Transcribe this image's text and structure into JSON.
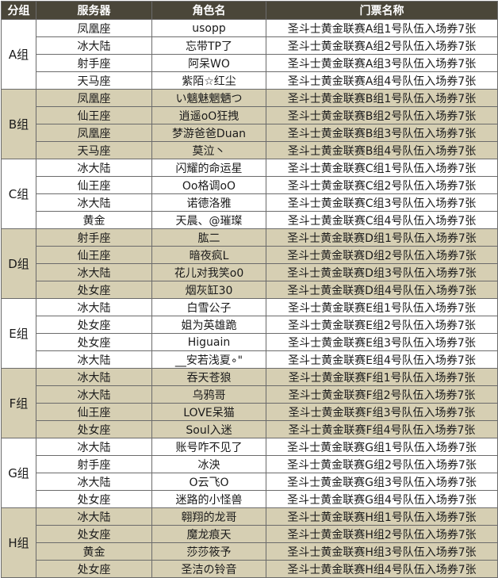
{
  "headers": {
    "group": "分组",
    "server": "服务器",
    "role": "角色名",
    "ticket": "门票名称"
  },
  "groups": [
    {
      "name": "A组",
      "rows": [
        {
          "server": "凤凰座",
          "role": "usopp",
          "ticket": "圣斗士黄金联赛A组1号队伍入场券7张"
        },
        {
          "server": "冰大陆",
          "role": "忘带TP了",
          "ticket": "圣斗士黄金联赛A组2号队伍入场券7张"
        },
        {
          "server": "射手座",
          "role": "阿呆WO",
          "ticket": "圣斗士黄金联赛A组3号队伍入场券7张"
        },
        {
          "server": "天马座",
          "role": "紫陌☆红尘",
          "ticket": "圣斗士黄金联赛A组4号队伍入场券7张"
        }
      ]
    },
    {
      "name": "B组",
      "rows": [
        {
          "server": "凤凰座",
          "role": "い魑魅魍魉つ",
          "ticket": "圣斗士黄金联赛B组1号队伍入场券7张"
        },
        {
          "server": "仙王座",
          "role": "逍遥oO狂拽",
          "ticket": "圣斗士黄金联赛B组2号队伍入场券7张"
        },
        {
          "server": "凤凰座",
          "role": "梦游爸爸Duan",
          "ticket": "圣斗士黄金联赛B组3号队伍入场券7张"
        },
        {
          "server": "天马座",
          "role": "莫泣丶",
          "ticket": "圣斗士黄金联赛B组4号队伍入场券7张"
        }
      ]
    },
    {
      "name": "C组",
      "rows": [
        {
          "server": "冰大陆",
          "role": "闪耀的命运星",
          "ticket": "圣斗士黄金联赛C组1号队伍入场券7张"
        },
        {
          "server": "仙王座",
          "role": "Oo格调oO",
          "ticket": "圣斗士黄金联赛C组2号队伍入场券7张"
        },
        {
          "server": "冰大陆",
          "role": "诺德洛雅",
          "ticket": "圣斗士黄金联赛C组3号队伍入场券7张"
        },
        {
          "server": "黄金",
          "role": "天晨、@璀璨",
          "ticket": "圣斗士黄金联赛C组4号队伍入场券7张"
        }
      ]
    },
    {
      "name": "D组",
      "rows": [
        {
          "server": "射手座",
          "role": "肱二",
          "ticket": "圣斗士黄金联赛D组1号队伍入场券7张"
        },
        {
          "server": "仙王座",
          "role": "暗夜疯L",
          "ticket": "圣斗士黄金联赛D组2号队伍入场券7张"
        },
        {
          "server": "冰大陆",
          "role": "花儿对我笑o0",
          "ticket": "圣斗士黄金联赛D组3号队伍入场券7张"
        },
        {
          "server": "处女座",
          "role": "烟灰缸30",
          "ticket": "圣斗士黄金联赛D组4号队伍入场券7张"
        }
      ]
    },
    {
      "name": "E组",
      "rows": [
        {
          "server": "冰大陆",
          "role": "白雪公子",
          "ticket": "圣斗士黄金联赛E组1号队伍入场券7张"
        },
        {
          "server": "处女座",
          "role": "姐为英雄跪",
          "ticket": "圣斗士黄金联赛E组2号队伍入场券7张"
        },
        {
          "server": "处女座",
          "role": "Higuain",
          "ticket": "圣斗士黄金联赛E组3号队伍入场券7张"
        },
        {
          "server": "冰大陆",
          "role": "__安若浅夏∘\"",
          "ticket": "圣斗士黄金联赛E组4号队伍入场券7张"
        }
      ]
    },
    {
      "name": "F组",
      "rows": [
        {
          "server": "冰大陆",
          "role": "吞天苍狼",
          "ticket": "圣斗士黄金联赛F组1号队伍入场券7张"
        },
        {
          "server": "冰大陆",
          "role": "乌鸦哥",
          "ticket": "圣斗士黄金联赛F组2号队伍入场券7张"
        },
        {
          "server": "仙王座",
          "role": "LOVE呆猫",
          "ticket": "圣斗士黄金联赛F组3号队伍入场券7张"
        },
        {
          "server": "处女座",
          "role": "Soul入迷",
          "ticket": "圣斗士黄金联赛F组4号队伍入场券7张"
        }
      ]
    },
    {
      "name": "G组",
      "rows": [
        {
          "server": "冰大陆",
          "role": "账号咋不见了",
          "ticket": "圣斗士黄金联赛G组1号队伍入场券7张"
        },
        {
          "server": "射手座",
          "role": "冰泱",
          "ticket": "圣斗士黄金联赛G组2号队伍入场券7张"
        },
        {
          "server": "冰大陆",
          "role": "O云飞O",
          "ticket": "圣斗士黄金联赛G组3号队伍入场券7张"
        },
        {
          "server": "处女座",
          "role": "迷路的小怪兽",
          "ticket": "圣斗士黄金联赛G组4号队伍入场券7张"
        }
      ]
    },
    {
      "name": "H组",
      "rows": [
        {
          "server": "冰大陆",
          "role": "翱翔的龙哥",
          "ticket": "圣斗士黄金联赛H组1号队伍入场券7张"
        },
        {
          "server": "处女座",
          "role": "魔龙痕天",
          "ticket": "圣斗士黄金联赛H组2号队伍入场券7张"
        },
        {
          "server": "黄金",
          "role": "莎莎筱予",
          "ticket": "圣斗士黄金联赛H组3号队伍入场券7张"
        },
        {
          "server": "处女座",
          "role": "圣洁の铃音",
          "ticket": "圣斗士黄金联赛H组4号队伍入场券7张"
        }
      ]
    }
  ],
  "colors": {
    "header_bg": "#4a4639",
    "header_text": "#ffffff",
    "odd_group_bg": "#ffffff",
    "even_group_bg": "#d6cfb3",
    "border": "#6b6b6b"
  }
}
